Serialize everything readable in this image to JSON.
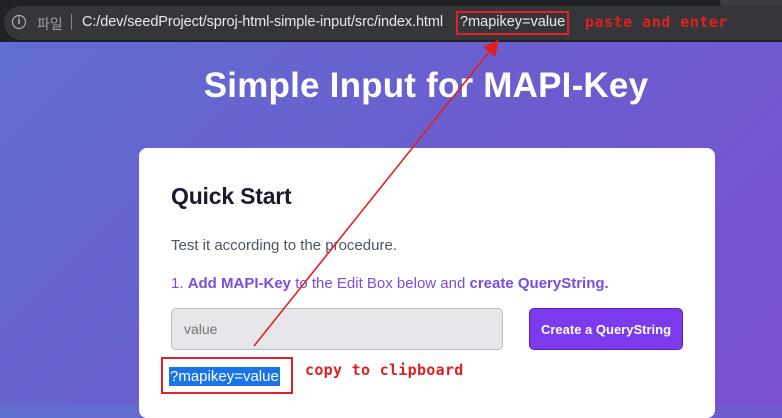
{
  "browser": {
    "scheme_label": "파일",
    "url_path": "C:/dev/seedProject/sproj-html-simple-input/src/index.html",
    "url_query": "?mapikey=value"
  },
  "annotations": {
    "paste_note": "paste and enter",
    "copy_note": "copy to clipboard",
    "color": "#e02020"
  },
  "page": {
    "heading": "Simple Input for MAPI-Key"
  },
  "card": {
    "title": "Quick Start",
    "intro": "Test it according to the procedure.",
    "step": {
      "number": "1.",
      "part1": "Add MAPI-Key",
      "part2": "to the Edit Box below and",
      "part3": "create QueryString."
    },
    "input": {
      "value": "",
      "placeholder": "value"
    },
    "button_label": "Create a QueryString",
    "output": "?mapikey=value"
  },
  "colors": {
    "accent": "#7c3aed",
    "step_text": "#7c4ddc",
    "selection": "#1a73e8"
  }
}
